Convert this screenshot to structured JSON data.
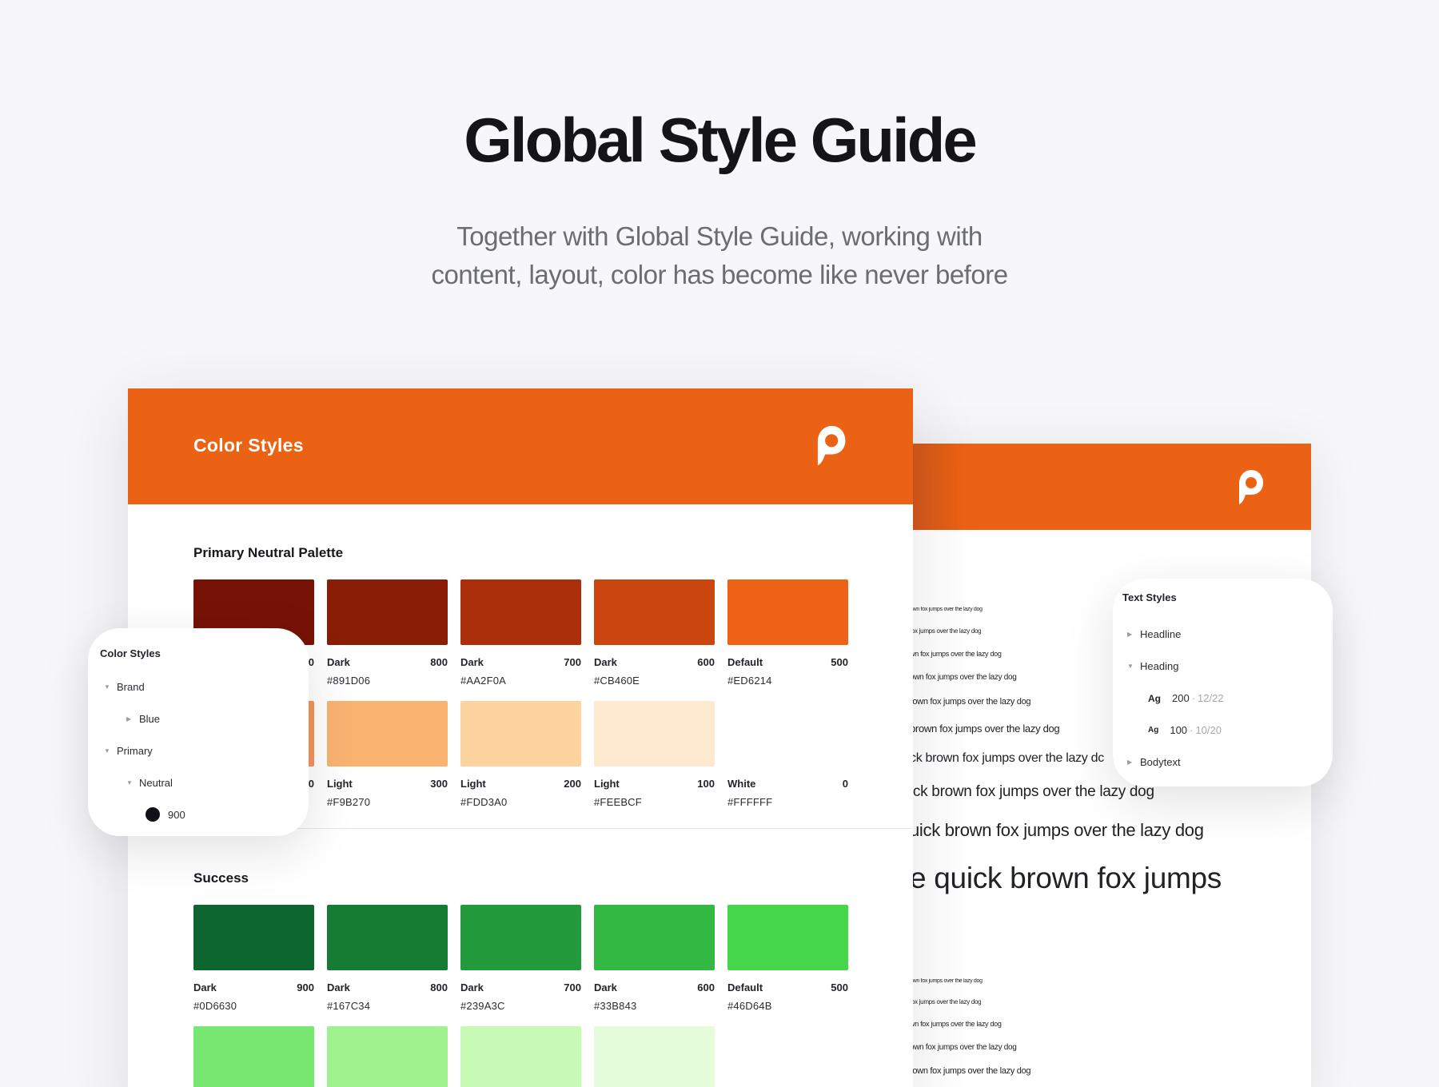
{
  "hero": {
    "title": "Global Style Guide",
    "subtitle_line1": "Together with Global Style Guide, working with",
    "subtitle_line2": "content, layout, color has become like never before"
  },
  "main_card": {
    "header_title": "Color Styles",
    "logo_icon": "p-logo-icon",
    "primary": {
      "title": "Primary Neutral Palette",
      "row1": [
        {
          "label": "",
          "weight": "0",
          "hex": "",
          "color": "#771206"
        },
        {
          "label": "Dark",
          "weight": "800",
          "hex": "#891D06",
          "color": "#891D06"
        },
        {
          "label": "Dark",
          "weight": "700",
          "hex": "#AA2F0A",
          "color": "#AA2F0A"
        },
        {
          "label": "Dark",
          "weight": "600",
          "hex": "#CB460E",
          "color": "#CB460E"
        },
        {
          "label": "Default",
          "weight": "500",
          "hex": "#ED6214",
          "color": "#ED6214"
        }
      ],
      "row2": [
        {
          "label": "",
          "weight": "0",
          "hex": "",
          "color": "#F3955A"
        },
        {
          "label": "Light",
          "weight": "300",
          "hex": "#F9B270",
          "color": "#F9B270"
        },
        {
          "label": "Light",
          "weight": "200",
          "hex": "#FDD3A0",
          "color": "#FDD3A0"
        },
        {
          "label": "Light",
          "weight": "100",
          "hex": "#FEEBCF",
          "color": "#FEEBCF"
        },
        {
          "label": "White",
          "weight": "0",
          "hex": "#FFFFFF",
          "color": "#FFFFFF"
        }
      ]
    },
    "success": {
      "title": "Success",
      "row1": [
        {
          "label": "Dark",
          "weight": "900",
          "hex": "#0D6630",
          "color": "#0D6630"
        },
        {
          "label": "Dark",
          "weight": "800",
          "hex": "#167C34",
          "color": "#167C34"
        },
        {
          "label": "Dark",
          "weight": "700",
          "hex": "#239A3C",
          "color": "#239A3C"
        },
        {
          "label": "Dark",
          "weight": "600",
          "hex": "#33B843",
          "color": "#33B843"
        },
        {
          "label": "Default",
          "weight": "500",
          "hex": "#46D64B",
          "color": "#46D64B"
        }
      ],
      "row2": [
        {
          "color": "#78E770"
        },
        {
          "color": "#9FF28E"
        },
        {
          "color": "#C6FAB5"
        },
        {
          "color": "#E5FCDB"
        }
      ]
    }
  },
  "color_panel": {
    "title": "Color Styles",
    "brand": "Brand",
    "blue": "Blue",
    "primary": "Primary",
    "neutral": "Neutral",
    "swatch_900": "900"
  },
  "text_panel": {
    "title": "Text Styles",
    "headline": "Headline",
    "heading": "Heading",
    "h200": "200",
    "h200_lh": "12/22",
    "h100": "100",
    "h100_lh": "10/20",
    "ag": "Ag",
    "bodytext": "Bodytext"
  },
  "samples": {
    "s1": "own fox jumps over the lazy dog",
    "s2": "fox jumps over the lazy dog",
    "s3": "wn fox jumps over the lazy dog",
    "s4": "own fox jumps over the lazy dog",
    "s5": "rown fox jumps over the lazy dog",
    "s6": " brown fox jumps over the lazy dog",
    "s7": "ck brown fox jumps over the lazy dc",
    "s8": "ick brown fox jumps over the lazy dog",
    "s9": "uick brown fox jumps over the lazy dog",
    "s10": "e quick brown fox jumps",
    "s11": "own fox jumps over the lazy dog",
    "s12": "fox jumps over the lazy dog",
    "s13": "wn fox jumps over the lazy dog",
    "s14": "own fox jumps over the lazy dog",
    "s15": "rown fox jumps over the lazy dog"
  }
}
